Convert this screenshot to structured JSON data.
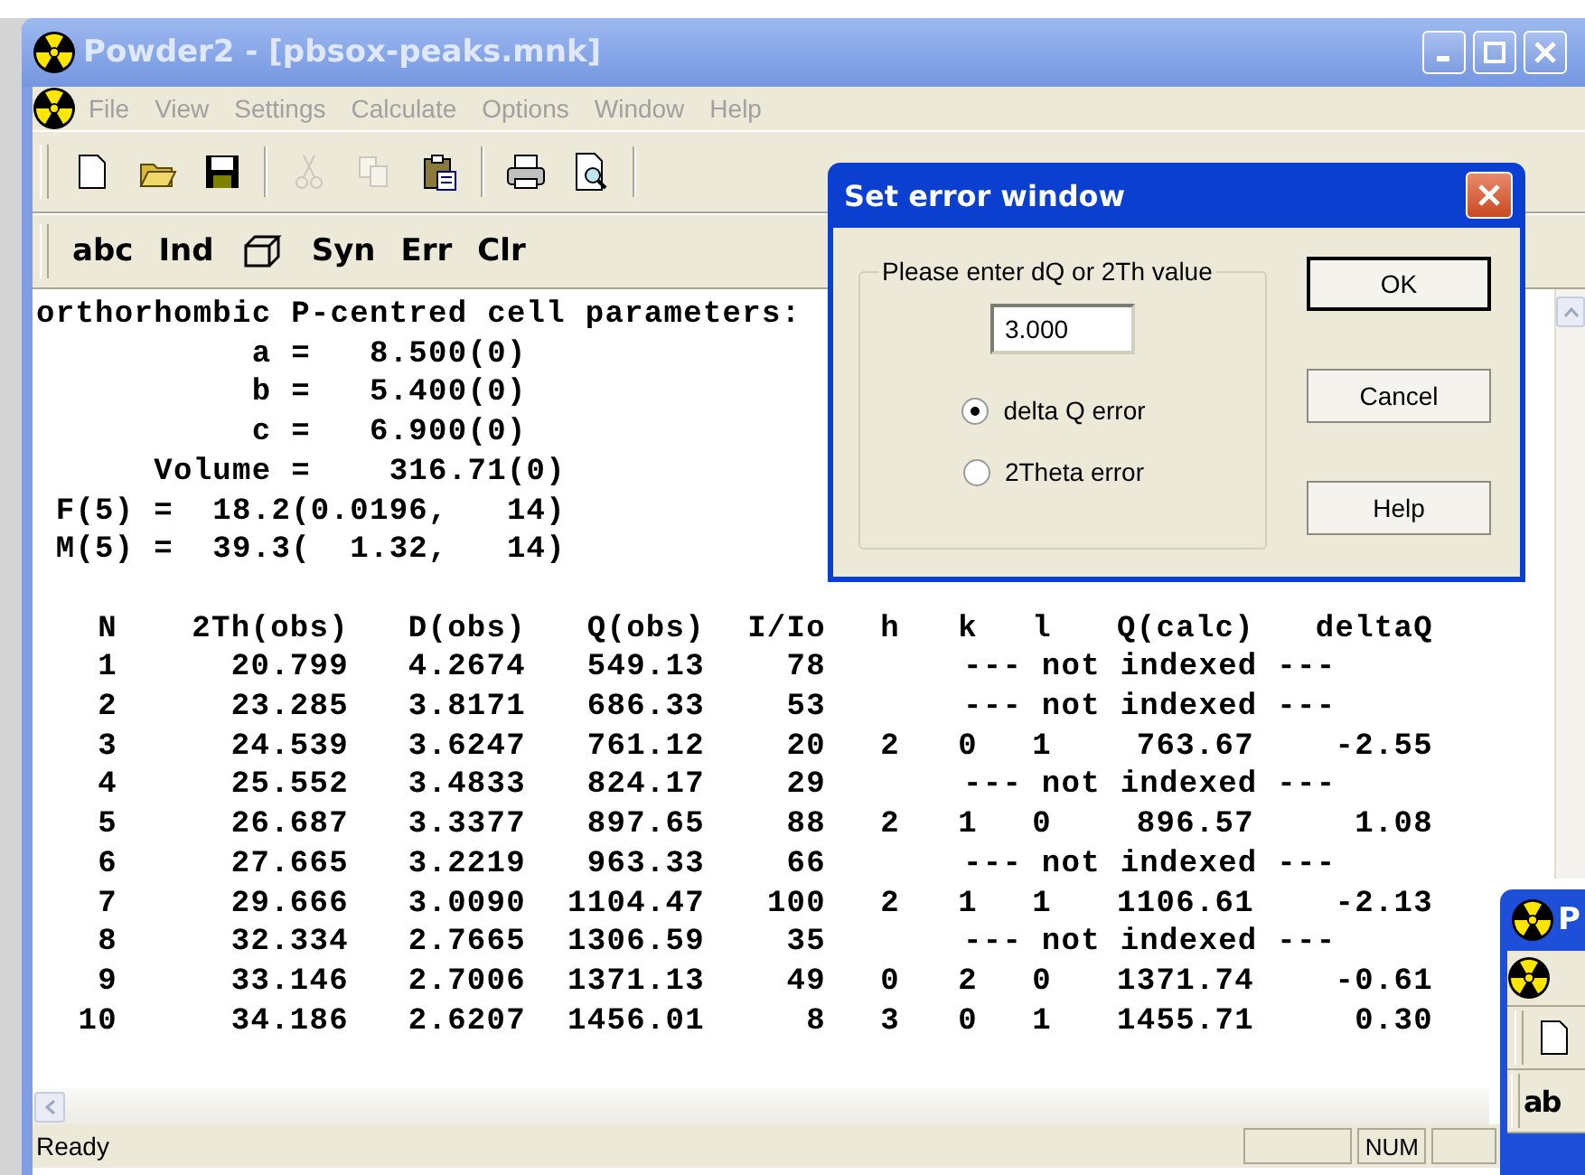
{
  "window": {
    "title": "Powder2 - [pbsox-peaks.mnk]"
  },
  "menu": [
    {
      "label": "File",
      "disabled": true
    },
    {
      "label": "View",
      "disabled": true
    },
    {
      "label": "Settings",
      "disabled": true
    },
    {
      "label": "Calculate",
      "disabled": true
    },
    {
      "label": "Options",
      "disabled": true
    },
    {
      "label": "Window",
      "disabled": true
    },
    {
      "label": "Help",
      "disabled": true
    }
  ],
  "toolbar": [
    {
      "kind": "new",
      "disabled": false
    },
    {
      "kind": "open",
      "disabled": false
    },
    {
      "kind": "save",
      "disabled": false
    },
    {
      "kind": "sep"
    },
    {
      "kind": "cut",
      "disabled": true
    },
    {
      "kind": "copy",
      "disabled": true
    },
    {
      "kind": "paste",
      "disabled": false
    },
    {
      "kind": "sep"
    },
    {
      "kind": "print",
      "disabled": false
    },
    {
      "kind": "preview",
      "disabled": false
    }
  ],
  "toolbar2": [
    {
      "kind": "text",
      "label": "abc"
    },
    {
      "kind": "text",
      "label": "Ind"
    },
    {
      "kind": "cube"
    },
    {
      "kind": "text",
      "label": "Syn"
    },
    {
      "kind": "text",
      "label": "Err"
    },
    {
      "kind": "text",
      "label": "Clr"
    }
  ],
  "cell_parameters": [
    "orthorhombic P-centred cell parameters:",
    "           a =   8.500(0)",
    "           b =   5.400(0)",
    "           c =   6.900(0)",
    "      Volume =    316.71(0)",
    " F(5) =  18.2(0.0196,   14)",
    " M(5) =  39.3(  1.32,   14)"
  ],
  "table": {
    "columns": [
      "N",
      "2Th(obs)",
      "D(obs)",
      "Q(obs)",
      "I/Io",
      "h",
      "k",
      "l",
      "Q(calc)",
      "deltaQ"
    ],
    "rows": [
      {
        "kind": "unindexed",
        "cells": [
          "1",
          "20.799",
          "4.2674",
          "549.13",
          "78"
        ],
        "note": "--- not indexed ---"
      },
      {
        "kind": "unindexed",
        "cells": [
          "2",
          "23.285",
          "3.8171",
          "686.33",
          "53"
        ],
        "note": "--- not indexed ---"
      },
      {
        "kind": "indexed",
        "cells": [
          "3",
          "24.539",
          "3.6247",
          "761.12",
          "20",
          "2",
          "0",
          "1",
          "763.67",
          "-2.55"
        ]
      },
      {
        "kind": "unindexed",
        "cells": [
          "4",
          "25.552",
          "3.4833",
          "824.17",
          "29"
        ],
        "note": "--- not indexed ---"
      },
      {
        "kind": "indexed",
        "cells": [
          "5",
          "26.687",
          "3.3377",
          "897.65",
          "88",
          "2",
          "1",
          "0",
          "896.57",
          "1.08"
        ]
      },
      {
        "kind": "unindexed",
        "cells": [
          "6",
          "27.665",
          "3.2219",
          "963.33",
          "66"
        ],
        "note": "--- not indexed ---"
      },
      {
        "kind": "indexed",
        "cells": [
          "7",
          "29.666",
          "3.0090",
          "1104.47",
          "100",
          "2",
          "1",
          "1",
          "1106.61",
          "-2.13"
        ]
      },
      {
        "kind": "unindexed",
        "cells": [
          "8",
          "32.334",
          "2.7665",
          "1306.59",
          "35"
        ],
        "note": "--- not indexed ---"
      },
      {
        "kind": "indexed",
        "cells": [
          "9",
          "33.146",
          "2.7006",
          "1371.13",
          "49",
          "0",
          "2",
          "0",
          "1371.74",
          "-0.61"
        ]
      },
      {
        "kind": "indexed",
        "cells": [
          "10",
          "34.186",
          "2.6207",
          "1456.01",
          "8",
          "3",
          "0",
          "1",
          "1455.71",
          "0.30"
        ]
      }
    ]
  },
  "status_bar": {
    "text": "Ready",
    "panes": [
      "NUM"
    ]
  },
  "dialog": {
    "title": "Set error window",
    "group_label": "Please enter dQ or 2Th value",
    "value": "3.000",
    "options": [
      {
        "label": "delta Q error",
        "selected": true
      },
      {
        "label": "2Theta error",
        "selected": false
      }
    ],
    "buttons": [
      {
        "label": "OK",
        "default": true
      },
      {
        "label": "Cancel",
        "default": false
      },
      {
        "label": "Help",
        "default": false
      }
    ]
  },
  "second_window": {
    "title": "P",
    "toolbar_text": "ab"
  }
}
